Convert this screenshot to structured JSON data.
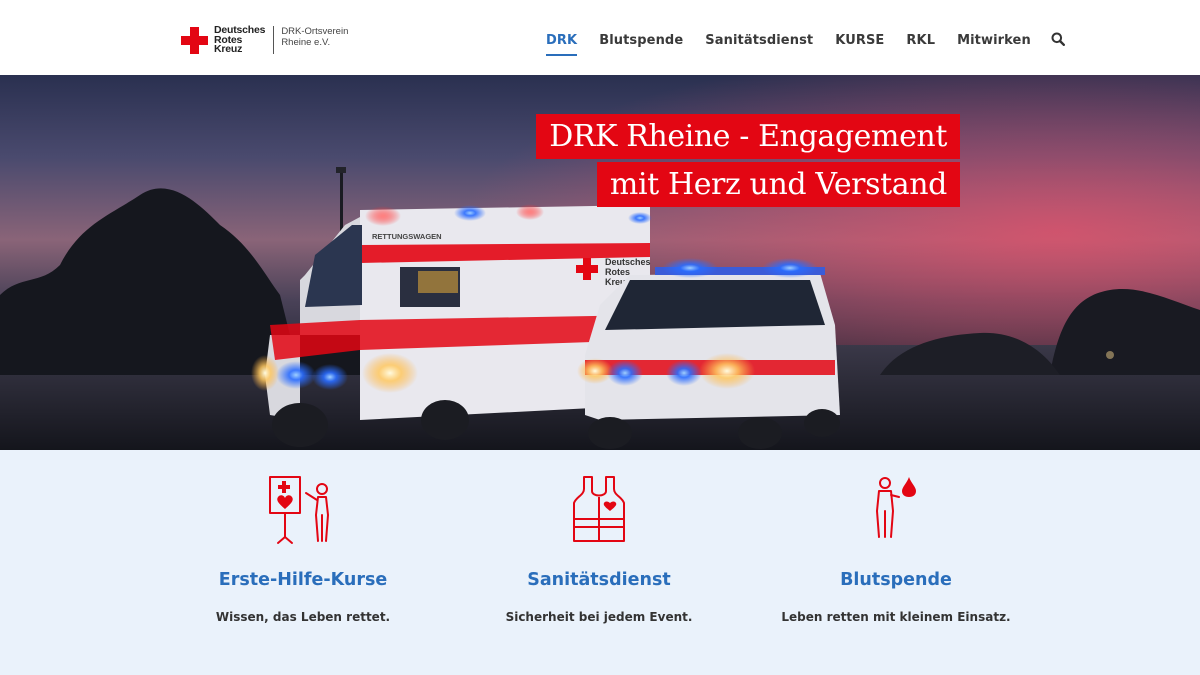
{
  "header": {
    "logo": {
      "line1": "Deutsches",
      "line2": "Rotes",
      "line3": "Kreuz",
      "sub1": "DRK-Ortsverein",
      "sub2": "Rheine e.V."
    },
    "nav": [
      {
        "label": "DRK",
        "active": true
      },
      {
        "label": "Blutspende",
        "active": false
      },
      {
        "label": "Sanitätsdienst",
        "active": false
      },
      {
        "label": "KURSE",
        "active": false
      },
      {
        "label": "RKL",
        "active": false
      },
      {
        "label": "Mitwirken",
        "active": false
      }
    ],
    "search_icon": "search-icon"
  },
  "hero": {
    "headline_line1": "DRK Rheine - Engagement",
    "headline_line2": "mit Herz und Verstand",
    "vehicle_labels": {
      "ambulance_top": "RETTUNGSWAGEN",
      "side1": "Deutsches",
      "side2": "Rotes",
      "side3": "Kreuz"
    }
  },
  "services": [
    {
      "title": "Erste-Hilfe-Kurse",
      "subtitle": "Wissen, das Leben rettet.",
      "icon": "first-aid-instructor-icon"
    },
    {
      "title": "Sanitätsdienst",
      "subtitle": "Sicherheit bei jedem Event.",
      "icon": "medic-vest-icon"
    },
    {
      "title": "Blutspende",
      "subtitle": "Leben retten mit kleinem Einsatz.",
      "icon": "blood-donor-icon"
    }
  ],
  "colors": {
    "brand_red": "#e30613",
    "link_blue": "#2a6ebb",
    "services_bg": "#eaf2fb"
  }
}
